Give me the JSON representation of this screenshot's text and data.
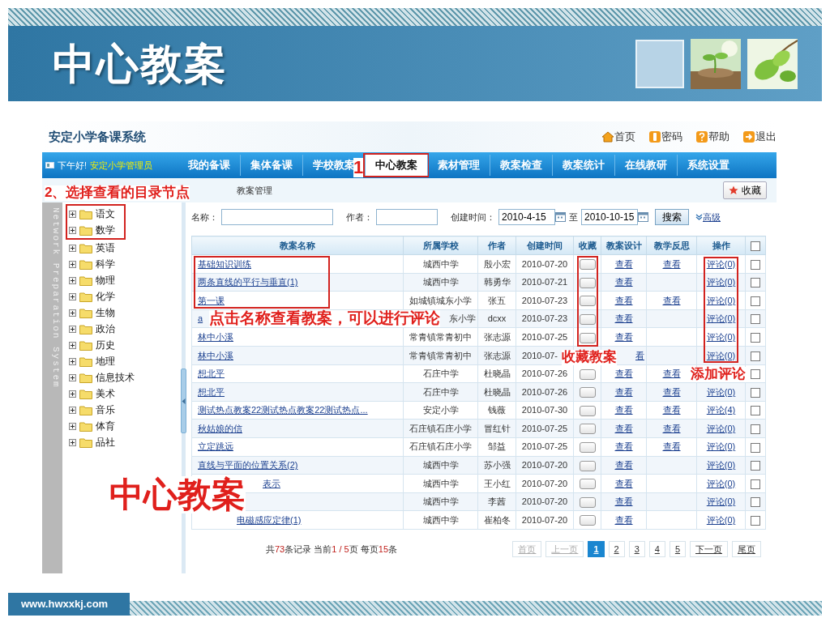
{
  "slide": {
    "title": "中心教案",
    "footer": "www.hwxxkj.com"
  },
  "app": {
    "logo": "安定小学备课系统",
    "top_links": [
      {
        "label": "首页",
        "kind": "home"
      },
      {
        "label": "密码",
        "kind": "key"
      },
      {
        "label": "帮助",
        "kind": "help"
      },
      {
        "label": "退出",
        "kind": "exit"
      }
    ],
    "greeting": {
      "prefix": "下午好!",
      "user": "安定小学管理员"
    },
    "nav": [
      {
        "label": "我的备课",
        "selected": false
      },
      {
        "label": "集体备课",
        "selected": false
      },
      {
        "label": "学校教案",
        "selected": false
      },
      {
        "label": "中心教案",
        "selected": true
      },
      {
        "label": "素材管理",
        "selected": false
      },
      {
        "label": "教案检查",
        "selected": false
      },
      {
        "label": "教案统计",
        "selected": false
      },
      {
        "label": "在线教研",
        "selected": false
      },
      {
        "label": "系统设置",
        "selected": false
      }
    ],
    "breadcrumb": "教案管理",
    "bookmark_button": "收藏",
    "tree": {
      "side_label": "Network Preparation System",
      "items": [
        {
          "label": "语文",
          "expanded": false
        },
        {
          "label": "数学",
          "expanded": false
        },
        {
          "label": "英语",
          "expanded": false
        },
        {
          "label": "科学",
          "expanded": false
        },
        {
          "label": "物理",
          "expanded": false
        },
        {
          "label": "化学",
          "expanded": false
        },
        {
          "label": "生物",
          "expanded": false
        },
        {
          "label": "政治",
          "expanded": false
        },
        {
          "label": "历史",
          "expanded": false
        },
        {
          "label": "地理",
          "expanded": false
        },
        {
          "label": "信息技术",
          "expanded": false
        },
        {
          "label": "美术",
          "expanded": false
        },
        {
          "label": "音乐",
          "expanded": false
        },
        {
          "label": "体育",
          "expanded": false
        },
        {
          "label": "品社",
          "expanded": false
        }
      ]
    },
    "search": {
      "name_label": "名称：",
      "author_label": "作者：",
      "date_label": "创建时间：",
      "date_from": "2010-4-15",
      "date_to_label": "至",
      "date_to": "2010-10-15",
      "button": "搜索",
      "advanced": "高级"
    },
    "table": {
      "columns": [
        "教案名称",
        "所属学校",
        "作者",
        "创建时间",
        "收藏",
        "教案设计",
        "教学反思",
        "操作"
      ],
      "select_all_checked": false,
      "rows": [
        {
          "name": "基础知识训练",
          "school": "城西中学",
          "author": "殷小宏",
          "date": "2010-07-20",
          "favorited": false,
          "design": "查看",
          "reflection": "查看",
          "comment": "评论(0)",
          "checked": false
        },
        {
          "name": "两条直线的平行与垂直(1)",
          "school": "城西中学",
          "author": "韩勇华",
          "date": "2010-07-21",
          "favorited": false,
          "design": "查看",
          "comment": "评论(0)",
          "checked": false
        },
        {
          "name": "第一课",
          "school": "如城镇城东小学",
          "author": "张五",
          "date": "2010-07-23",
          "favorited": false,
          "design": "查看",
          "reflection": "查看",
          "comment": "评论(0)",
          "checked": false
        },
        {
          "name": "a",
          "school": "东小学",
          "author": "dcxx",
          "date": "2010-07-23",
          "favorited": false,
          "design": "查看",
          "comment": "评论(0)",
          "checked": false
        },
        {
          "name": "林中小溪",
          "school": "常青镇常青初中",
          "author": "张志源",
          "date": "2010-07-25",
          "favorited": false,
          "design": "查看",
          "comment": "评论(0)",
          "checked": false
        },
        {
          "name": "林中小溪",
          "school": "常青镇常青初中",
          "author": "张志源",
          "date": "2010-07-",
          "design": "看",
          "comment": "评论(0)",
          "checked": false
        },
        {
          "name": "想北平",
          "school": "石庄中学",
          "author": "杜晓晶",
          "date": "2010-07-26",
          "favorited": false,
          "design": "查看",
          "reflection": "查看",
          "checked": false
        },
        {
          "name": "想北平",
          "school": "石庄中学",
          "author": "杜晓晶",
          "date": "2010-07-26",
          "favorited": false,
          "design": "查看",
          "reflection": "查看",
          "comment": "评论(0)",
          "checked": false
        },
        {
          "name": "测试热点教案22测试热点教案22测试热点...",
          "school": "安定小学",
          "author": "钱薇",
          "date": "2010-07-30",
          "favorited": false,
          "design": "查看",
          "reflection": "查看",
          "comment": "评论(4)",
          "checked": false
        },
        {
          "name": "秋姑娘的信",
          "school": "石庄镇石庄小学",
          "author": "冒红针",
          "date": "2010-07-25",
          "favorited": false,
          "design": "查看",
          "reflection": "查看",
          "comment": "评论(0)",
          "checked": false
        },
        {
          "name": "立定跳远",
          "school": "石庄镇石庄小学",
          "author": "邹益",
          "date": "2010-07-25",
          "favorited": false,
          "design": "查看",
          "reflection": "查看",
          "comment": "评论(0)",
          "checked": false
        },
        {
          "name": "直线与平面的位置关系(2)",
          "school": "城西中学",
          "author": "苏小强",
          "date": "2010-07-20",
          "favorited": false,
          "design": "查看",
          "comment": "评论(0)",
          "checked": false
        },
        {
          "name": "表示",
          "school": "城西中学",
          "author": "王小红",
          "date": "2010-07-20",
          "favorited": false,
          "design": "查看",
          "comment": "评论(0)",
          "checked": false
        },
        {
          "school": "城西中学",
          "author": "李茜",
          "date": "2010-07-20",
          "favorited": false,
          "design": "查看",
          "comment": "评论(0)",
          "checked": false
        },
        {
          "name": "电磁感应定律(1)",
          "school": "城西中学",
          "author": "崔柏冬",
          "date": "2010-07-20",
          "favorited": false,
          "design": "查看",
          "comment": "评论(0)",
          "checked": false
        }
      ]
    },
    "pagination": {
      "summary": [
        {
          "text": "共",
          "highlight": false
        },
        {
          "text": "73",
          "highlight": true
        },
        {
          "text": "条记录  当前",
          "highlight": false
        },
        {
          "text": "1 / 5",
          "highlight": true
        },
        {
          "text": "页  每页",
          "highlight": false
        },
        {
          "text": "15",
          "highlight": true
        },
        {
          "text": "条",
          "highlight": false
        }
      ],
      "pages": [
        {
          "label": "首页",
          "disabled": true,
          "selected": false
        },
        {
          "label": "上一页",
          "disabled": true,
          "selected": false
        },
        {
          "label": "1",
          "disabled": false,
          "selected": true
        },
        {
          "label": "2",
          "disabled": false,
          "selected": false
        },
        {
          "label": "3",
          "disabled": false,
          "selected": false
        },
        {
          "label": "4",
          "disabled": false,
          "selected": false
        },
        {
          "label": "5",
          "disabled": false,
          "selected": false
        },
        {
          "label": "下一页",
          "disabled": false,
          "selected": false
        },
        {
          "label": "尾页",
          "disabled": false,
          "selected": false
        }
      ]
    }
  },
  "annotations": {
    "step_marker": "1",
    "tree_hint": "2、选择查看的目录节点",
    "name_hint": "点击名称查看教案，可以进行评论",
    "favorite_hint": "收藏教案",
    "comment_hint": "添加评论",
    "stamp": "中心教案"
  }
}
